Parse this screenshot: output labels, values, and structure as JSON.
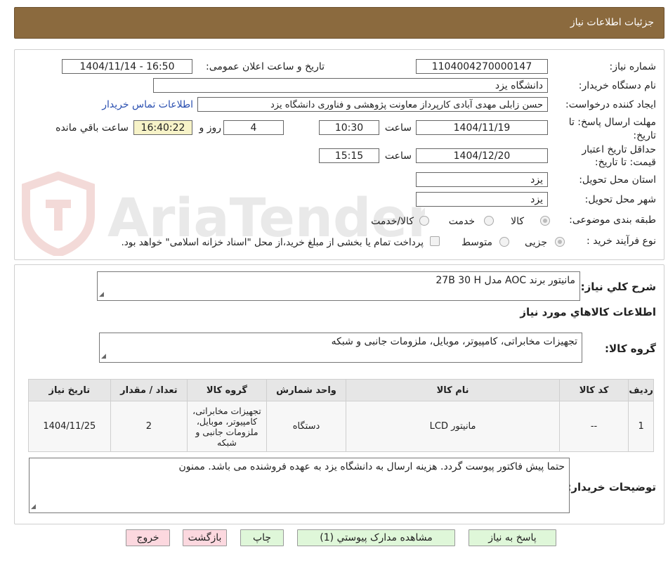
{
  "header": {
    "title": "جزئیات اطلاعات نیاز"
  },
  "form": {
    "need_number_label": "شماره نیاز:",
    "need_number": "1104004270000147",
    "announce_label": "تاریخ و ساعت اعلان عمومی:",
    "announce_value": "1404/11/14 - 16:50",
    "buyer_org_label": "نام دستگاه خریدار:",
    "buyer_org": "دانشگاه یزد",
    "requester_label": "ایجاد کننده درخواست:",
    "requester": "حسن زابلی مهدی آبادی کارپرداز معاونت پژوهشی و فناوری دانشگاه یزد",
    "contact_link": "اطلاعات تماس خریدار",
    "deadline_label_1": "مهلت ارسال پاسخ: تا",
    "deadline_label_2": "تاریخ:",
    "deadline_date": "1404/11/19",
    "time_label": "ساعت",
    "deadline_time": "10:30",
    "days_value": "4",
    "days_label": "روز و",
    "remaining_time": "16:40:22",
    "remaining_label": "ساعت باقي مانده",
    "validity_label_1": "حداقل تاریخ اعتبار",
    "validity_label_2": "قیمت: تا تاریخ:",
    "validity_date": "1404/12/20",
    "validity_time": "15:15",
    "province_label": "استان محل تحویل:",
    "province": "یزد",
    "city_label": "شهر محل تحویل:",
    "city": "یزد",
    "category_label": "طبقه بندی موضوعی:",
    "category_options": [
      "کالا",
      "خدمت",
      "کالا/خدمت"
    ],
    "process_label": "نوع فرآیند خرید :",
    "process_options": [
      "جزیی",
      "متوسط"
    ],
    "payment_note": "پرداخت تمام یا بخشی از مبلغ خرید،از محل \"اسناد خزانه اسلامی\" خواهد بود."
  },
  "watermark": {
    "text": "AriaTender.neT"
  },
  "description": {
    "label": "شرح کلي نياز:",
    "value": "مانیتور برند AOC مدل  27B 30 H"
  },
  "goods_info": {
    "title": "اطلاعات کالاهاي مورد نياز",
    "group_label": "گروه کالا:",
    "group_value": "تجهیزات مخابراتی، کامپیوتر، موبایل، ملزومات جانبی و شبکه"
  },
  "table": {
    "headers": [
      "ردیف",
      "کد کالا",
      "نام کالا",
      "واحد شمارش",
      "گروه کالا",
      "تعداد / مقدار",
      "تاریخ نیاز"
    ],
    "rows": [
      [
        "1",
        "--",
        "مانیتور LCD",
        "دستگاه",
        "تجهیزات مخابراتی، کامپیوتر، موبایل، ملزومات جانبی و شبکه",
        "2",
        "1404/11/25"
      ]
    ]
  },
  "buyer_notes": {
    "label": "توضیحات خریدار:",
    "value": "حتما پیش فاکتور پیوست گردد. هزینه ارسال به دانشگاه یزد به عهده فروشنده می باشد. ممنون"
  },
  "buttons": {
    "reply": "پاسخ به نیاز",
    "attachments": "مشاهده مدارک پیوستي (1)",
    "print": "چاپ",
    "back": "بازگشت",
    "exit": "خروج"
  },
  "colors": {
    "header_bg": "#8b6a3e",
    "accent_button": "#dff7d9",
    "danger_button": "#fcd8df",
    "highlight_field": "#f7f3c8",
    "link": "#2a4fb0"
  }
}
